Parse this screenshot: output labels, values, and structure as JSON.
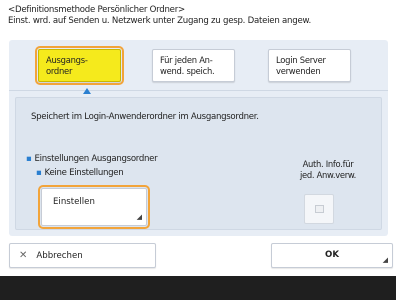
{
  "header": {
    "line1": "<Definitionsmethode Persönlicher Ordner>",
    "line2": "Einst. wrd. auf Senden u. Netzwerk unter Zugang zu gesp. Dateien angew."
  },
  "tabs": [
    {
      "line1": "Ausgangs-",
      "line2": "ordner",
      "selected": true
    },
    {
      "line1": "Für jeden An-",
      "line2": "wend. speich.",
      "selected": false
    },
    {
      "line1": "Login Server",
      "line2": "verwenden",
      "selected": false
    }
  ],
  "description": "Speichert im Login-Anwenderordner im Ausgangsordner.",
  "settings": {
    "title": "Einstellungen Ausgangsordner",
    "value": "Keine Einstellungen"
  },
  "set_button": {
    "label": "Einstellen",
    "corner_icon": "corner-arrow-icon"
  },
  "auth": {
    "line1": "Auth. Info.für",
    "line2": "jed. Anw.verw.",
    "checked": false
  },
  "buttons": {
    "cancel": {
      "label": "Abbrechen",
      "icon": "close-icon"
    },
    "ok": {
      "label": "OK"
    }
  },
  "colors": {
    "selected_tab": "#f5ea1c",
    "highlight": "#f2a43a",
    "accent_blue": "#2a7fd0",
    "panel": "#e7edf5",
    "footer": "#1f1f1f"
  }
}
